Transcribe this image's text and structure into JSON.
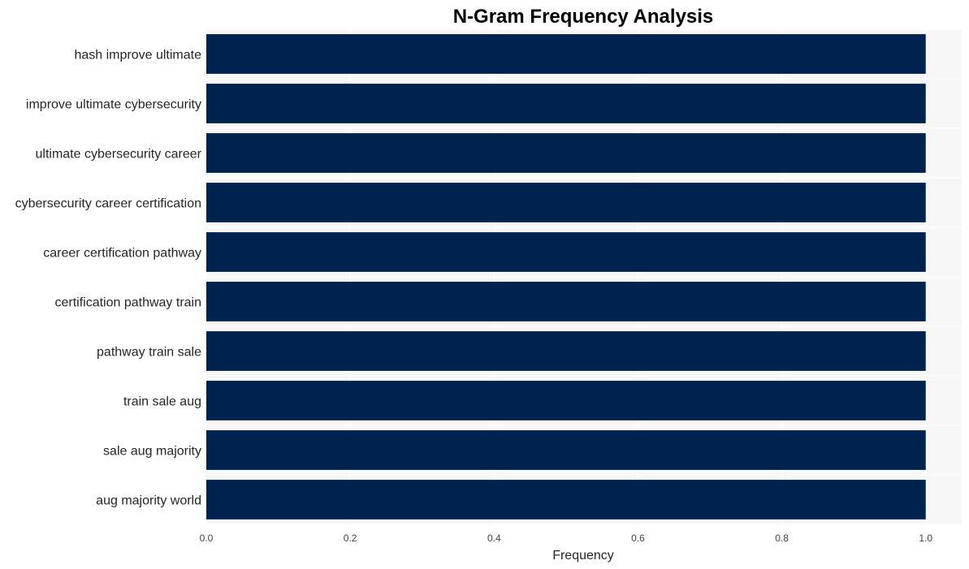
{
  "chart_data": {
    "type": "bar",
    "orientation": "horizontal",
    "title": "N-Gram Frequency Analysis",
    "xlabel": "Frequency",
    "ylabel": "",
    "categories": [
      "hash improve ultimate",
      "improve ultimate cybersecurity",
      "ultimate cybersecurity career",
      "cybersecurity career certification",
      "career certification pathway",
      "certification pathway train",
      "pathway train sale",
      "train sale aug",
      "sale aug majority",
      "aug majority world"
    ],
    "values": [
      1,
      1,
      1,
      1,
      1,
      1,
      1,
      1,
      1,
      1
    ],
    "xlim": [
      0,
      1.05
    ],
    "xticks": [
      0.0,
      0.2,
      0.4,
      0.6,
      0.8,
      1.0
    ],
    "xtick_labels": [
      "0.0",
      "0.2",
      "0.4",
      "0.6",
      "0.8",
      "1.0"
    ],
    "grid": true,
    "legend": "none",
    "colors": {
      "bar": "#00224e",
      "plot_background": "#f7f7f7",
      "grid": "#ffffff"
    }
  }
}
